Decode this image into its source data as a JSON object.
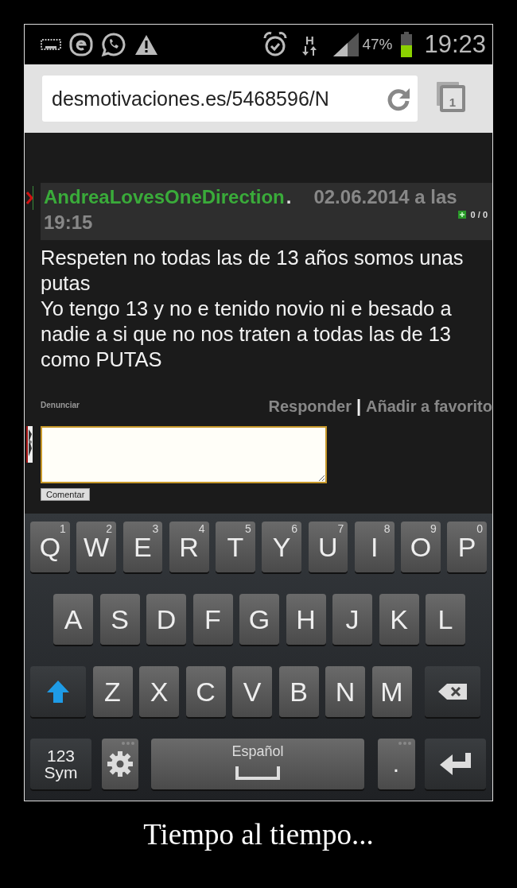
{
  "status_bar": {
    "network_type": "H",
    "battery_percent": "47%",
    "time": "19:23"
  },
  "browser": {
    "url": "desmotivaciones.es/5468596/N",
    "tab_count": "1"
  },
  "comment": {
    "author": "AndreaLovesOneDirection",
    "separator": ".",
    "date": "02.06.2014 a las",
    "time": "19:15",
    "votes": "0 / 0",
    "paragraphs": [
      "Respeten no todas las de 13 años somos unas putas",
      "Yo tengo 13 y no e tenido novio ni e besado a nadie a si que no nos traten a todas las de 13 como PUTAS"
    ],
    "report_link": "Denunciar",
    "actions": [
      "Responder",
      "Añadir a favorito"
    ],
    "actions_divider": "|",
    "submit_button": "Comentar"
  },
  "keyboard": {
    "rows": [
      {
        "keys": [
          {
            "kind": "letter",
            "label": "Q",
            "hint": "1"
          },
          {
            "kind": "letter",
            "label": "W",
            "hint": "2"
          },
          {
            "kind": "letter",
            "label": "E",
            "hint": "3"
          },
          {
            "kind": "letter",
            "label": "R",
            "hint": "4"
          },
          {
            "kind": "letter",
            "label": "T",
            "hint": "5"
          },
          {
            "kind": "letter",
            "label": "Y",
            "hint": "6"
          },
          {
            "kind": "letter",
            "label": "U",
            "hint": "7"
          },
          {
            "kind": "letter",
            "label": "I",
            "hint": "8"
          },
          {
            "kind": "letter",
            "label": "O",
            "hint": "9"
          },
          {
            "kind": "letter",
            "label": "P",
            "hint": "0"
          }
        ]
      },
      {
        "keys": [
          {
            "kind": "letter",
            "label": "A"
          },
          {
            "kind": "letter",
            "label": "S"
          },
          {
            "kind": "letter",
            "label": "D"
          },
          {
            "kind": "letter",
            "label": "F"
          },
          {
            "kind": "letter",
            "label": "G"
          },
          {
            "kind": "letter",
            "label": "H"
          },
          {
            "kind": "letter",
            "label": "J"
          },
          {
            "kind": "letter",
            "label": "K"
          },
          {
            "kind": "letter",
            "label": "L"
          }
        ]
      },
      {
        "keys": [
          {
            "kind": "shift"
          },
          {
            "kind": "letter",
            "label": "Z"
          },
          {
            "kind": "letter",
            "label": "X"
          },
          {
            "kind": "letter",
            "label": "C"
          },
          {
            "kind": "letter",
            "label": "V"
          },
          {
            "kind": "letter",
            "label": "B"
          },
          {
            "kind": "letter",
            "label": "N"
          },
          {
            "kind": "letter",
            "label": "M"
          },
          {
            "kind": "backspace"
          }
        ]
      },
      {
        "keys": [
          {
            "kind": "symbols",
            "label": "123",
            "sublabel": "Sym"
          },
          {
            "kind": "settings"
          },
          {
            "kind": "space",
            "label": "Español"
          },
          {
            "kind": "period",
            "label": "."
          },
          {
            "kind": "enter"
          }
        ]
      }
    ]
  },
  "caption": "Tiempo al tiempo..."
}
